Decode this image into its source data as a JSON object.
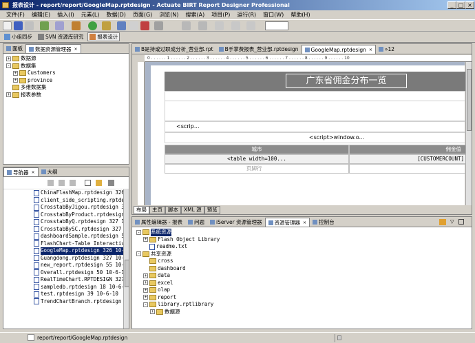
{
  "window": {
    "title": "报表设计 - report/report/GoogleMap.rptdesign - Actuate BIRT Report Designer Professional",
    "controls": {
      "min": "_",
      "max": "□",
      "close": "×"
    }
  },
  "menu": [
    "文件(F)",
    "编辑(E)",
    "插入(I)",
    "元素(L)",
    "数据(D)",
    "页面(G)",
    "浏览(N)",
    "搜索(A)",
    "项目(P)",
    "运行(R)",
    "窗口(W)",
    "帮助(H)"
  ],
  "toolbar2": {
    "items": [
      {
        "label": "小组同步"
      },
      {
        "label": "SVN 资源库研究"
      },
      {
        "label": "报表设计"
      }
    ]
  },
  "left_top": {
    "tabs": [
      {
        "label": "面板"
      },
      {
        "label": "数据资源管理器"
      }
    ],
    "tree": [
      {
        "label": "数据源",
        "indent": 0,
        "toggle": "+"
      },
      {
        "label": "数据集",
        "indent": 0,
        "toggle": "-"
      },
      {
        "label": "Customers",
        "indent": 1,
        "toggle": "+"
      },
      {
        "label": "province",
        "indent": 1,
        "toggle": "+"
      },
      {
        "label": "多维数据集",
        "indent": 0,
        "toggle": ""
      },
      {
        "label": "报表参数",
        "indent": 0,
        "toggle": "+"
      }
    ]
  },
  "left_bottom": {
    "tabs": [
      {
        "label": "导航器"
      },
      {
        "label": "大纲"
      }
    ],
    "files": [
      {
        "label": "ChinaFlashMap.rptdesign 326"
      },
      {
        "label": "client_side_scripting.rptdes"
      },
      {
        "label": "CrosstabByJigou.rptdesign 32"
      },
      {
        "label": "CrosstabByProduct.rptdesign"
      },
      {
        "label": "CrosstabByQ.rptdesign 327  1"
      },
      {
        "label": "CrosstabBySC.rptdesign 327"
      },
      {
        "label": "dashboardSample.rptdesign 51"
      },
      {
        "label": "FlashChart-Table Interactive"
      },
      {
        "label": "GoogleMap.rptdesign 326  10-",
        "selected": true
      },
      {
        "label": "Guangdong.rptdesign 327  10-"
      },
      {
        "label": "new_report.rptdesign 55  10-"
      },
      {
        "label": "Overall.rptdesign 50  10-6-1"
      },
      {
        "label": "RealTimeChart.RPTDESIGN 327"
      },
      {
        "label": "sampledb.rptdesign 18  10-6-"
      },
      {
        "label": "test.rptdesign 39  10-6-10"
      },
      {
        "label": "TrendChartBranch.rptdesign 3"
      }
    ]
  },
  "editor": {
    "tabs": [
      {
        "label": "B是持或过职成分析_营业部.rpt"
      },
      {
        "label": "B手掌费报表_营业部.rptdesign"
      },
      {
        "label": "GoogleMap.rptdesign",
        "active": true
      },
      {
        "label": "»12"
      }
    ],
    "report_title": "广东省佣金分布一览",
    "script1": "<scrip...",
    "script2": "<script>window.o...",
    "table_headers": [
      "城市",
      "佣金值"
    ],
    "table_row": [
      "<table width=100...",
      "[CUSTOMERCOUNT]"
    ],
    "footer_cell": "页脚行",
    "bottom_tabs": [
      "布局",
      "主页",
      "脚本",
      "XML 源",
      "预览"
    ]
  },
  "bottom_panel": {
    "tabs": [
      {
        "label": "属性编辑器 - 报表"
      },
      {
        "label": "问题"
      },
      {
        "label": "iServer 资源管理器"
      },
      {
        "label": "资源管理器",
        "active": true
      },
      {
        "label": "控制台"
      }
    ],
    "tree": [
      {
        "label": "系统资源",
        "indent": 0,
        "toggle": "-",
        "selected": true
      },
      {
        "label": "Flash Object Library",
        "indent": 1,
        "toggle": "+"
      },
      {
        "label": "readme.txt",
        "indent": 1,
        "toggle": "",
        "file": true
      },
      {
        "label": "共享资源",
        "indent": 0,
        "toggle": "-"
      },
      {
        "label": "cross",
        "indent": 1,
        "toggle": ""
      },
      {
        "label": "dashboard",
        "indent": 1,
        "toggle": ""
      },
      {
        "label": "data",
        "indent": 1,
        "toggle": "+"
      },
      {
        "label": "excel",
        "indent": 1,
        "toggle": "+"
      },
      {
        "label": "olap",
        "indent": 1,
        "toggle": "+"
      },
      {
        "label": "report",
        "indent": 1,
        "toggle": "+"
      },
      {
        "label": "library.rptlibrary",
        "indent": 1,
        "toggle": "-"
      },
      {
        "label": "数据源",
        "indent": 2,
        "toggle": "+"
      }
    ]
  },
  "status": {
    "path": "report/report/GoogleMap.rptdesign"
  }
}
